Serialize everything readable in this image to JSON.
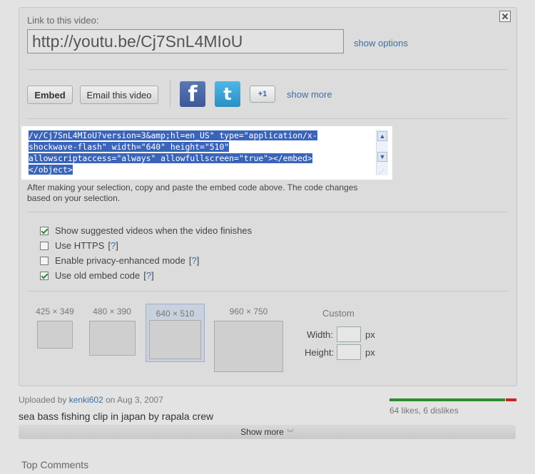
{
  "share": {
    "link_label": "Link to this video:",
    "url": "http://youtu.be/Cj7SnL4MIoU",
    "show_options": "show options",
    "embed_button": "Embed",
    "email_button": "Email this video",
    "show_more": "show more",
    "social_icons": [
      "facebook-icon",
      "twitter-icon",
      "google-plus-one-icon"
    ],
    "google_plus_text": "+1"
  },
  "embed": {
    "code_lines": [
      "/v/Cj7SnL4MIoU?version=3&amp;hl=en_US\" type=\"application/x-",
      "shockwave-flash\" width=\"640\" height=\"510\"",
      "allowscriptaccess=\"always\" allowfullscreen=\"true\"></embed>",
      "</object>"
    ],
    "help_line1": "After making your selection, copy and paste the embed code above. The code changes",
    "help_line2": "based on your selection."
  },
  "options": [
    {
      "label": "Show suggested videos when the video finishes",
      "checked": true,
      "help": ""
    },
    {
      "label": "Use HTTPS",
      "checked": false,
      "help": "?"
    },
    {
      "label": "Enable privacy-enhanced mode",
      "checked": false,
      "help": "?"
    },
    {
      "label": "Use old embed code",
      "checked": true,
      "help": "?"
    }
  ],
  "sizes": [
    {
      "label": "425 × 349",
      "selected": false
    },
    {
      "label": "480 × 390",
      "selected": false
    },
    {
      "label": "640 × 510",
      "selected": true
    },
    {
      "label": "960 × 750",
      "selected": false
    }
  ],
  "custom": {
    "title": "Custom",
    "width_label": "Width:",
    "height_label": "Height:",
    "unit": "px"
  },
  "video": {
    "uploaded_prefix": "Uploaded by",
    "uploader": "kenki602",
    "date_text": "on Aug 3, 2007",
    "title": "sea bass fishing clip in japan by rapala crew",
    "likes_text": "64 likes, 6 dislikes",
    "like_fraction": 0.914,
    "show_more": "Show more"
  },
  "comments": {
    "heading": "Top Comments"
  },
  "colors": {
    "like": "#2e8b2e",
    "dislike": "#c8232b",
    "link": "#3d6fa6",
    "selection": "#3a64b9"
  }
}
